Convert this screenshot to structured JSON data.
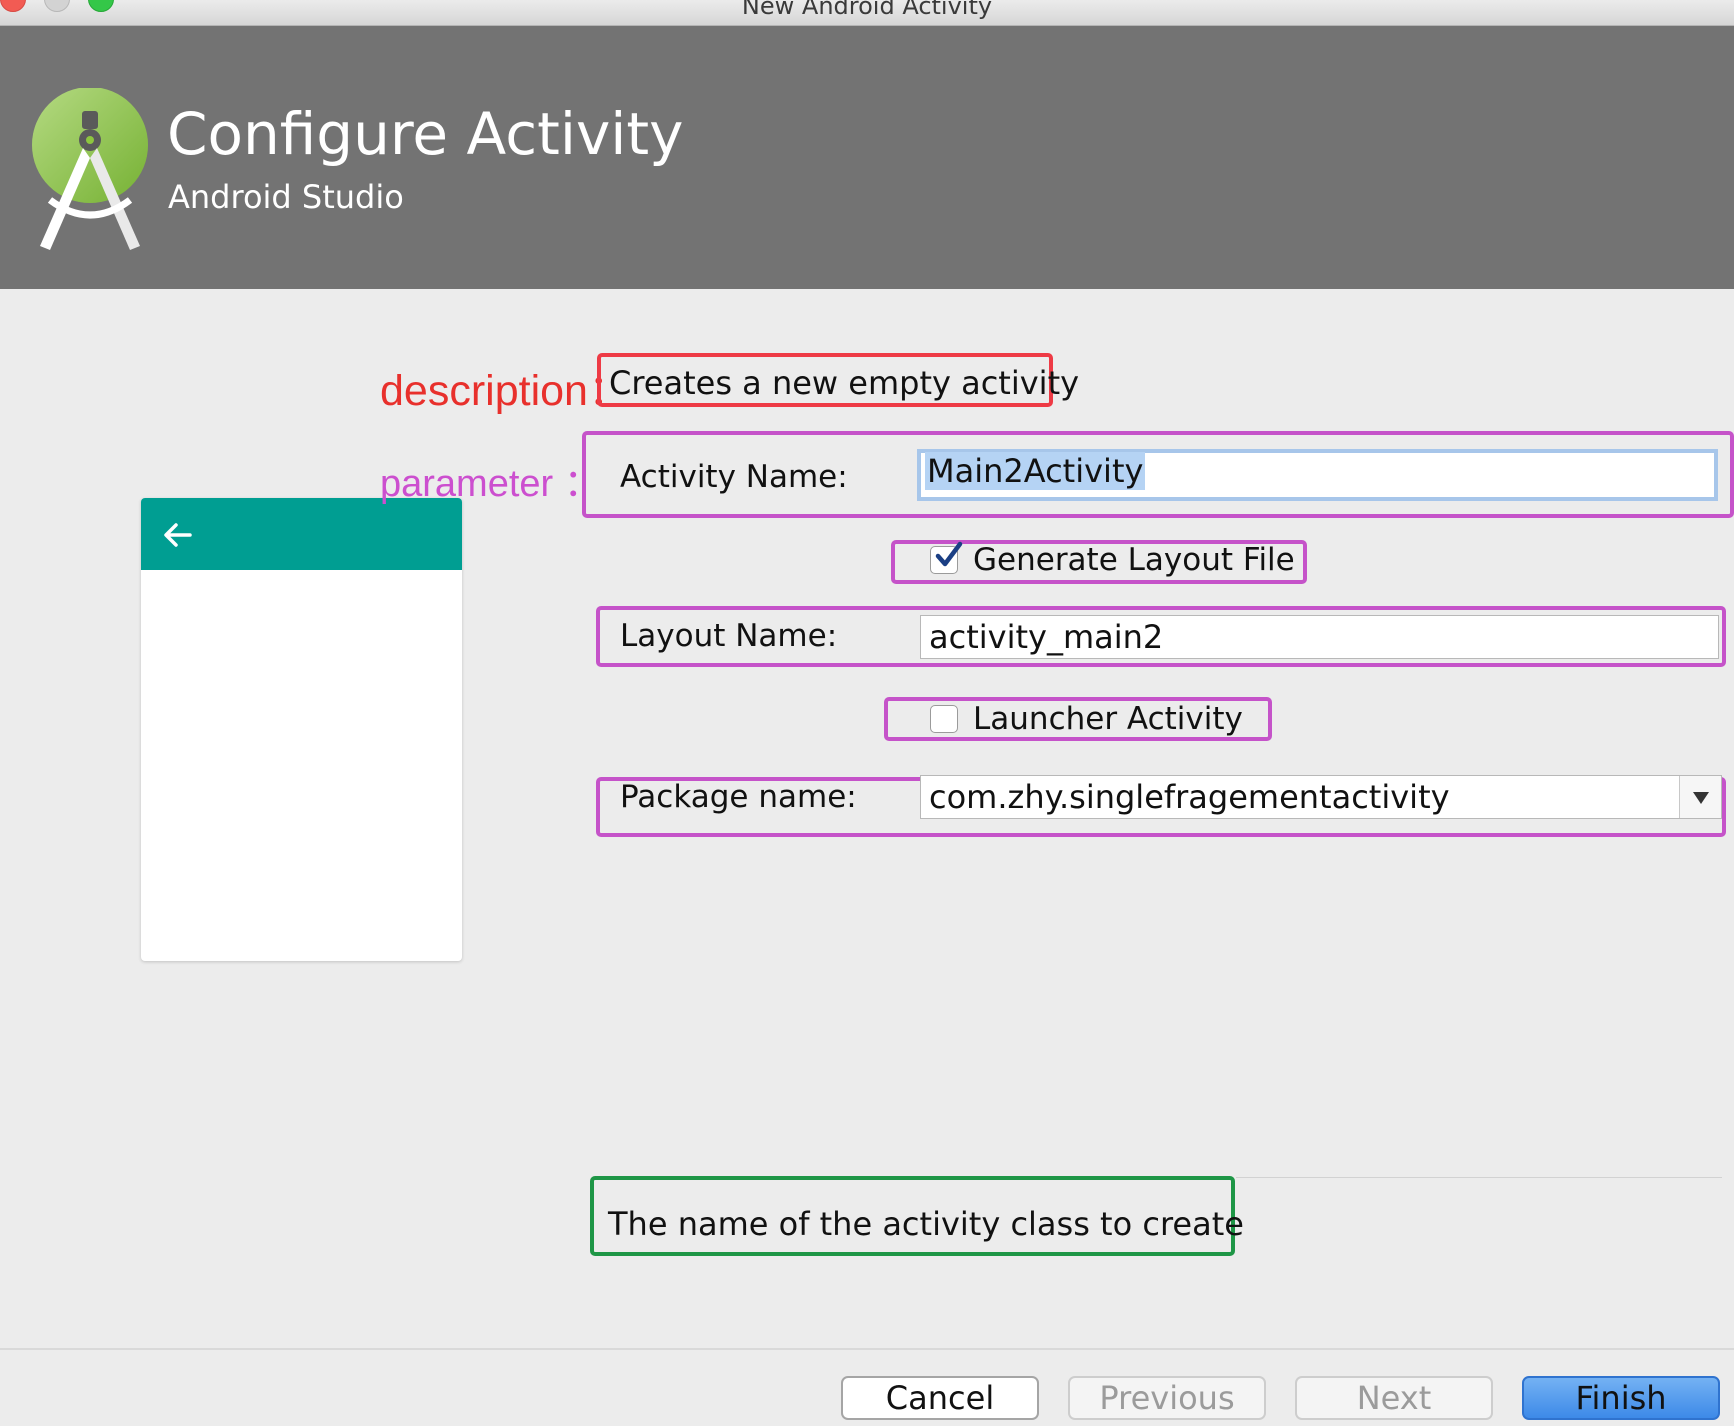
{
  "window": {
    "title": "New Android Activity"
  },
  "header": {
    "title": "Configure Activity",
    "subtitle": "Android Studio"
  },
  "annotations": {
    "description_label": "description：",
    "parameter_label": "parameter ："
  },
  "form": {
    "description": "Creates a new empty activity",
    "activity_name": {
      "label": "Activity Name:",
      "value": "Main2Activity"
    },
    "generate_layout": {
      "label": "Generate Layout File",
      "checked": true
    },
    "layout_name": {
      "label": "Layout Name:",
      "value": "activity_main2"
    },
    "launcher_activity": {
      "label": "Launcher Activity",
      "checked": false
    },
    "package_name": {
      "label": "Package name:",
      "value": "com.zhy.singlefragementactivity"
    }
  },
  "help_text": "The name of the activity class to create",
  "buttons": {
    "cancel": "Cancel",
    "previous": "Previous",
    "next": "Next",
    "finish": "Finish"
  },
  "colors": {
    "header_bg": "#737373",
    "toolbar_teal": "#009e92",
    "annotation_red": "#ee3a45",
    "annotation_magenta": "#c553c9",
    "annotation_green": "#1e9646",
    "finish_blue": "#3d8ae8"
  },
  "icons": {
    "logo": "android-studio-logo-icon",
    "back": "arrow-left-icon",
    "dropdown": "chevron-down-icon",
    "check": "check-icon"
  }
}
